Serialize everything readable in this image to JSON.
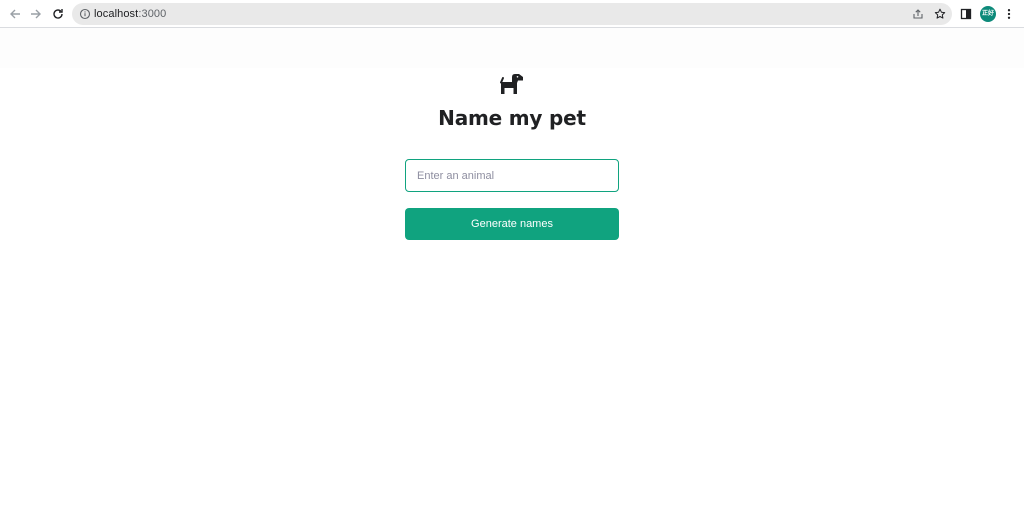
{
  "browser": {
    "url_host": "localhost",
    "url_port": ":3000",
    "profile_initials": "正好"
  },
  "icons": {
    "back": "arrow-left-icon",
    "forward": "arrow-right-icon",
    "reload": "reload-icon",
    "site_info": "info-circle-icon",
    "share": "share-icon",
    "bookmark": "star-icon",
    "side_panel": "side-panel-icon",
    "menu": "kebab-menu-icon",
    "logo": "dog-icon"
  },
  "page": {
    "title": "Name my pet",
    "animal_input": {
      "placeholder": "Enter an animal",
      "value": ""
    },
    "generate_label": "Generate names"
  },
  "colors": {
    "accent": "#10a37f",
    "title": "#202123",
    "avatar_bg": "#0d8a7a"
  }
}
